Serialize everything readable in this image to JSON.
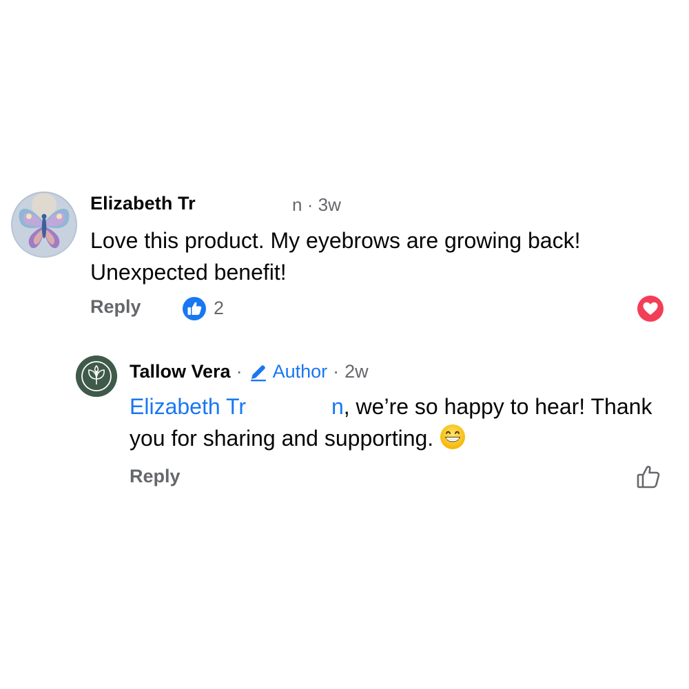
{
  "comments": [
    {
      "author": "Elizabeth Tr",
      "author_trailing": "n",
      "time": "3w",
      "body": "Love this product. My eyebrows are growing back!\nUnexpected benefit!",
      "reply_label": "Reply",
      "like_count": "2",
      "reactions": [
        "like-icon",
        "heart-icon"
      ],
      "avatar": "butterfly-art"
    },
    {
      "author": "Tallow Vera",
      "badge_label": "Author",
      "time": "2w",
      "mention": "Elizabeth Tr",
      "mention_trailing": "n",
      "body": ", we’re so happy to hear! Thank you for sharing and supporting.",
      "emoji": "grinning-face",
      "reply_label": "Reply",
      "avatar": "brand-logo"
    }
  ],
  "separator": "·",
  "colors": {
    "text": "#050505",
    "secondary": "#65676b",
    "link": "#1877f2",
    "like_badge": "#1877f2",
    "love_badge": "#f33e58",
    "brand_avatar": "#3f5a49"
  }
}
